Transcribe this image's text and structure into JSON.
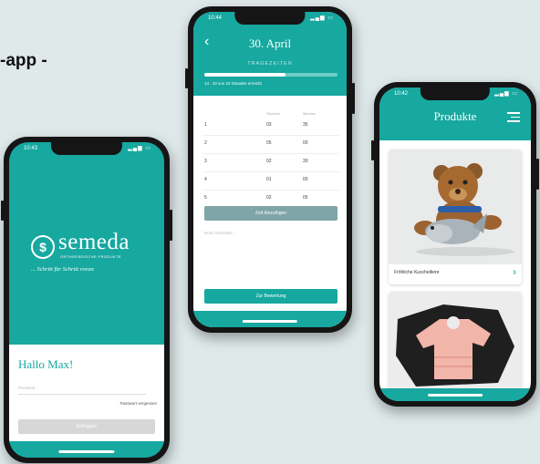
{
  "headline": "-app -",
  "colors": {
    "brand": "#17a8a0",
    "background": "#dfe9ea"
  },
  "login_screen": {
    "time": "10:43",
    "brand_name": "semeda",
    "brand_subline": "ORTHOPÄDISCHE PRODUKTE",
    "tagline": "... Schritt für Schritt voran",
    "greeting": "Hallo Max!",
    "password_placeholder": "Passwort",
    "forgot_password": "Passwort vergessen",
    "login_button": "Einloggen"
  },
  "diary_screen": {
    "time": "10:44",
    "date_title": "30. April",
    "section_title": "TRAGEZEITEN",
    "progress_text": "14 : 10 von 23 Stunden erreicht",
    "progress_fraction": 0.61,
    "columns": [
      "",
      "Stunden",
      "Minuten"
    ],
    "rows": [
      {
        "index": "1",
        "hours": "03",
        "minutes": "35"
      },
      {
        "index": "2",
        "hours": "05",
        "minutes": "00"
      },
      {
        "index": "3",
        "hours": "02",
        "minutes": "30"
      },
      {
        "index": "4",
        "hours": "01",
        "minutes": "00"
      },
      {
        "index": "5",
        "hours": "02",
        "minutes": "05"
      }
    ],
    "add_time_button": "Zeit hinzufügen",
    "note_placeholder": "Notiz schreiben ...",
    "rating_button": "Zur Bewertung"
  },
  "products_screen": {
    "time": "10:42",
    "title": "Produkte",
    "products": [
      {
        "label": "Fröhliche Kuscheltiere"
      }
    ]
  }
}
